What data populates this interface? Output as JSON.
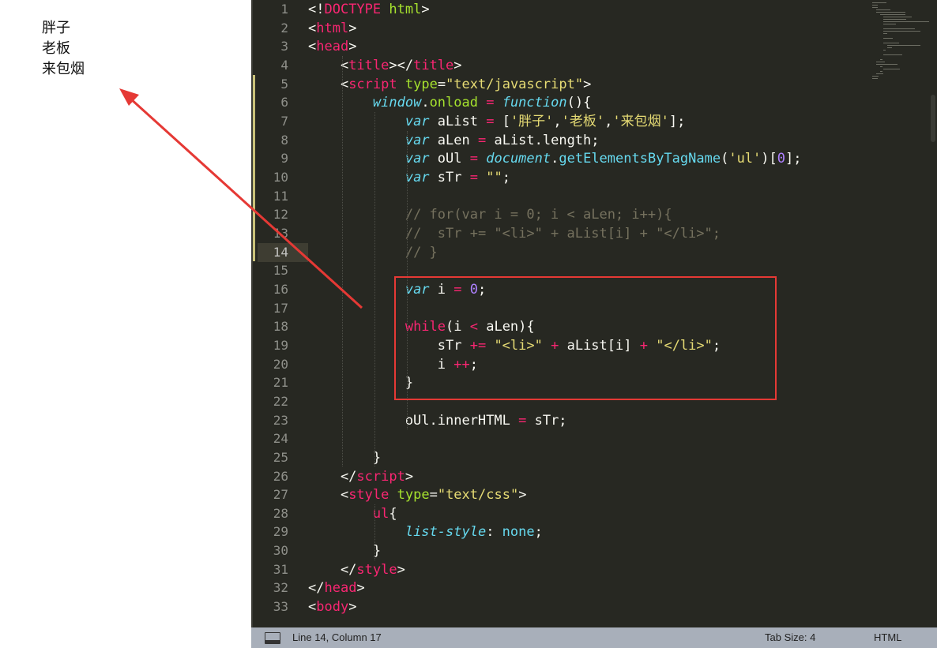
{
  "preview": {
    "items": [
      "胖子",
      "老板",
      "来包烟"
    ]
  },
  "editor": {
    "line_numbers": [
      "1",
      "2",
      "3",
      "4",
      "5",
      "6",
      "7",
      "8",
      "9",
      "10",
      "11",
      "12",
      "13",
      "14",
      "15",
      "16",
      "17",
      "18",
      "19",
      "20",
      "21",
      "22",
      "23",
      "24",
      "25",
      "26",
      "27",
      "28",
      "29",
      "30",
      "31",
      "32",
      "33"
    ],
    "current_line": "14",
    "code_lines": [
      [
        [
          "<!",
          "p"
        ],
        [
          "DOCTYPE",
          "t"
        ],
        [
          " ",
          "p"
        ],
        [
          "html",
          "a"
        ],
        [
          ">",
          "p"
        ]
      ],
      [
        [
          "<",
          "p"
        ],
        [
          "html",
          "t"
        ],
        [
          ">",
          "p"
        ]
      ],
      [
        [
          "<",
          "p"
        ],
        [
          "head",
          "t"
        ],
        [
          ">",
          "p"
        ]
      ],
      [
        [
          "    <",
          "p"
        ],
        [
          "title",
          "t"
        ],
        [
          "></",
          "p"
        ],
        [
          "title",
          "t"
        ],
        [
          ">",
          "p"
        ]
      ],
      [
        [
          "    <",
          "p"
        ],
        [
          "script",
          "t"
        ],
        [
          " ",
          "p"
        ],
        [
          "type",
          "a"
        ],
        [
          "=",
          "p"
        ],
        [
          "\"text/javascript\"",
          "s"
        ],
        [
          ">",
          "p"
        ]
      ],
      [
        [
          "        ",
          "p"
        ],
        [
          "window",
          "k"
        ],
        [
          ".",
          "p"
        ],
        [
          "onload",
          "a"
        ],
        [
          " = ",
          "t"
        ],
        [
          "function",
          "k"
        ],
        [
          "(){",
          "p"
        ]
      ],
      [
        [
          "            ",
          "p"
        ],
        [
          "var",
          "k"
        ],
        [
          " aList ",
          "p"
        ],
        [
          "=",
          "t"
        ],
        [
          " [",
          "p"
        ],
        [
          "'胖子'",
          "s"
        ],
        [
          ",",
          "p"
        ],
        [
          "'老板'",
          "s"
        ],
        [
          ",",
          "p"
        ],
        [
          "'来包烟'",
          "s"
        ],
        [
          "];",
          "p"
        ]
      ],
      [
        [
          "            ",
          "p"
        ],
        [
          "var",
          "k"
        ],
        [
          " aLen ",
          "p"
        ],
        [
          "=",
          "t"
        ],
        [
          " aList.length;",
          "p"
        ]
      ],
      [
        [
          "            ",
          "p"
        ],
        [
          "var",
          "k"
        ],
        [
          " oUl ",
          "p"
        ],
        [
          "=",
          "t"
        ],
        [
          " ",
          "p"
        ],
        [
          "document",
          "k"
        ],
        [
          ".",
          "p"
        ],
        [
          "getElementsByTagName",
          "f"
        ],
        [
          "(",
          "p"
        ],
        [
          "'ul'",
          "s"
        ],
        [
          ")[",
          "p"
        ],
        [
          "0",
          "n"
        ],
        [
          "];",
          "p"
        ]
      ],
      [
        [
          "            ",
          "p"
        ],
        [
          "var",
          "k"
        ],
        [
          " sTr ",
          "p"
        ],
        [
          "=",
          "t"
        ],
        [
          " ",
          "p"
        ],
        [
          "\"\"",
          "s"
        ],
        [
          ";",
          "p"
        ]
      ],
      [
        [
          "",
          "p"
        ]
      ],
      [
        [
          "            ",
          "p"
        ],
        [
          "// for(var i = 0; i < aLen; i++){",
          "c"
        ]
      ],
      [
        [
          "            ",
          "p"
        ],
        [
          "//  sTr += \"<li>\" + aList[i] + \"</li>\";",
          "c"
        ]
      ],
      [
        [
          "            ",
          "p"
        ],
        [
          "// }",
          "c"
        ]
      ],
      [
        [
          "",
          "p"
        ]
      ],
      [
        [
          "            ",
          "p"
        ],
        [
          "var",
          "k"
        ],
        [
          " i ",
          "p"
        ],
        [
          "=",
          "t"
        ],
        [
          " ",
          "p"
        ],
        [
          "0",
          "n"
        ],
        [
          ";",
          "p"
        ]
      ],
      [
        [
          "",
          "p"
        ]
      ],
      [
        [
          "            ",
          "p"
        ],
        [
          "while",
          "t"
        ],
        [
          "(i ",
          "p"
        ],
        [
          "<",
          "t"
        ],
        [
          " aLen){",
          "p"
        ]
      ],
      [
        [
          "                sTr ",
          "p"
        ],
        [
          "+=",
          "t"
        ],
        [
          " ",
          "p"
        ],
        [
          "\"<li>\"",
          "s"
        ],
        [
          " ",
          "p"
        ],
        [
          "+",
          "t"
        ],
        [
          " aList[i] ",
          "p"
        ],
        [
          "+",
          "t"
        ],
        [
          " ",
          "p"
        ],
        [
          "\"</li>\"",
          "s"
        ],
        [
          ";",
          "p"
        ]
      ],
      [
        [
          "                i ",
          "p"
        ],
        [
          "++",
          "t"
        ],
        [
          ";",
          "p"
        ]
      ],
      [
        [
          "            }",
          "p"
        ]
      ],
      [
        [
          "",
          "p"
        ]
      ],
      [
        [
          "            oUl.innerHTML ",
          "p"
        ],
        [
          "=",
          "t"
        ],
        [
          " sTr;",
          "p"
        ]
      ],
      [
        [
          "",
          "p"
        ]
      ],
      [
        [
          "        }",
          "p"
        ]
      ],
      [
        [
          "    </",
          "p"
        ],
        [
          "script",
          "t"
        ],
        [
          ">",
          "p"
        ]
      ],
      [
        [
          "    <",
          "p"
        ],
        [
          "style",
          "t"
        ],
        [
          " ",
          "p"
        ],
        [
          "type",
          "a"
        ],
        [
          "=",
          "p"
        ],
        [
          "\"text/css\"",
          "s"
        ],
        [
          ">",
          "p"
        ]
      ],
      [
        [
          "        ",
          "p"
        ],
        [
          "ul",
          "t"
        ],
        [
          "{",
          "p"
        ]
      ],
      [
        [
          "            ",
          "p"
        ],
        [
          "list-style",
          "k"
        ],
        [
          ": ",
          "p"
        ],
        [
          "none",
          "f"
        ],
        [
          ";",
          "p"
        ]
      ],
      [
        [
          "        }",
          "p"
        ]
      ],
      [
        [
          "    </",
          "p"
        ],
        [
          "style",
          "t"
        ],
        [
          ">",
          "p"
        ]
      ],
      [
        [
          "</",
          "p"
        ],
        [
          "head",
          "t"
        ],
        [
          ">",
          "p"
        ]
      ],
      [
        [
          "<",
          "p"
        ],
        [
          "body",
          "t"
        ],
        [
          ">",
          "p"
        ]
      ]
    ]
  },
  "statusbar": {
    "position": "Line 14, Column 17",
    "tab_size": "Tab Size: 4",
    "syntax": "HTML"
  }
}
